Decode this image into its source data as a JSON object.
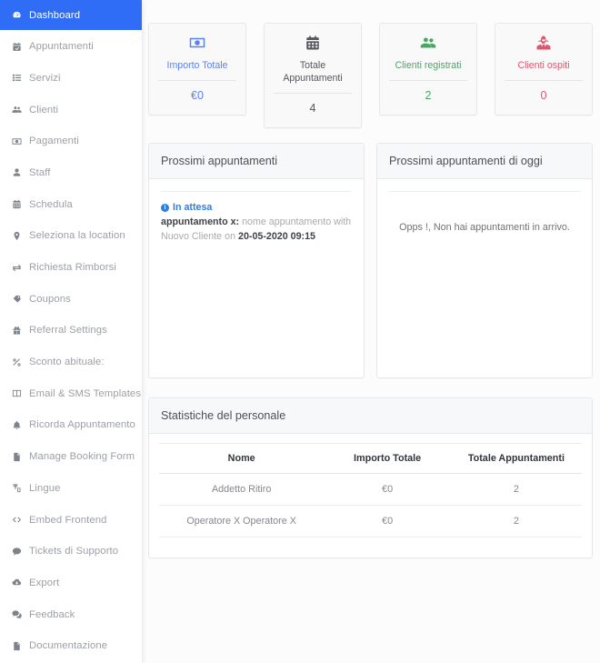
{
  "sidebar": {
    "items": [
      {
        "label": "Dashboard",
        "icon": "dashboard-icon",
        "active": true
      },
      {
        "label": "Appuntamenti",
        "icon": "calendar-check-icon",
        "active": false
      },
      {
        "label": "Servizi",
        "icon": "list-icon",
        "active": false
      },
      {
        "label": "Clienti",
        "icon": "users-icon",
        "active": false
      },
      {
        "label": "Pagamenti",
        "icon": "money-bill-icon",
        "active": false
      },
      {
        "label": "Staff",
        "icon": "user-icon",
        "active": false
      },
      {
        "label": "Schedula",
        "icon": "calendar-icon",
        "active": false
      },
      {
        "label": "Seleziona la location",
        "icon": "map-marker-icon",
        "active": false
      },
      {
        "label": "Richiesta Rimborsi",
        "icon": "exchange-icon",
        "active": false
      },
      {
        "label": "Coupons",
        "icon": "tags-icon",
        "active": false
      },
      {
        "label": "Referral Settings",
        "icon": "gift-icon",
        "active": false
      },
      {
        "label": "Sconto abituale:",
        "icon": "percent-icon",
        "active": false
      },
      {
        "label": "Email & SMS Templates",
        "icon": "columns-icon",
        "active": false
      },
      {
        "label": "Ricorda Appuntamento",
        "icon": "bell-icon",
        "active": false
      },
      {
        "label": "Manage Booking Form",
        "icon": "file-alt-icon",
        "active": false
      },
      {
        "label": "Lingue",
        "icon": "language-icon",
        "active": false
      },
      {
        "label": "Embed Frontend",
        "icon": "code-icon",
        "active": false
      },
      {
        "label": "Tickets di Supporto",
        "icon": "comment-icon",
        "active": false
      },
      {
        "label": "Export",
        "icon": "cloud-download-icon",
        "active": false
      },
      {
        "label": "Feedback",
        "icon": "comments-icon",
        "active": false
      },
      {
        "label": "Documentazione",
        "icon": "file-icon",
        "active": false
      }
    ]
  },
  "cards": [
    {
      "title": "Importo Totale",
      "value": "€0",
      "icon": "money-bill-icon",
      "color": "#5a82f7",
      "theme": "blue"
    },
    {
      "title": "Totale Appuntamenti",
      "value": "4",
      "icon": "calendar-icon",
      "color": "#56565c",
      "theme": "dark"
    },
    {
      "title": "Clienti registrati",
      "value": "2",
      "icon": "users-icon",
      "color": "#49a661",
      "theme": "green"
    },
    {
      "title": "Clienti ospiti",
      "value": "0",
      "icon": "user-secret-icon",
      "color": "#e1566f",
      "theme": "red"
    }
  ],
  "upcoming_panel": {
    "title": "Prossimi appuntamenti",
    "appointment": {
      "status": "In attesa",
      "status_icon": "info-circle-icon",
      "name": "appuntamento x",
      "separator": ":",
      "description": "nome appuntamento",
      "with_label": "with",
      "client": "Nuovo Cliente",
      "on_label": "on",
      "datetime": "20-05-2020 09:15"
    }
  },
  "today_panel": {
    "title": "Prossimi appuntamenti di oggi",
    "empty_message": "Opps !, Non hai appuntamenti in arrivo."
  },
  "staff_stats": {
    "title": "Statistiche del personale",
    "columns": [
      "Nome",
      "Importo Totale",
      "Totale Appuntamenti"
    ],
    "rows": [
      [
        "Addetto Ritiro",
        "€0",
        "2"
      ],
      [
        "Operatore X Operatore X",
        "€0",
        "2"
      ]
    ]
  }
}
